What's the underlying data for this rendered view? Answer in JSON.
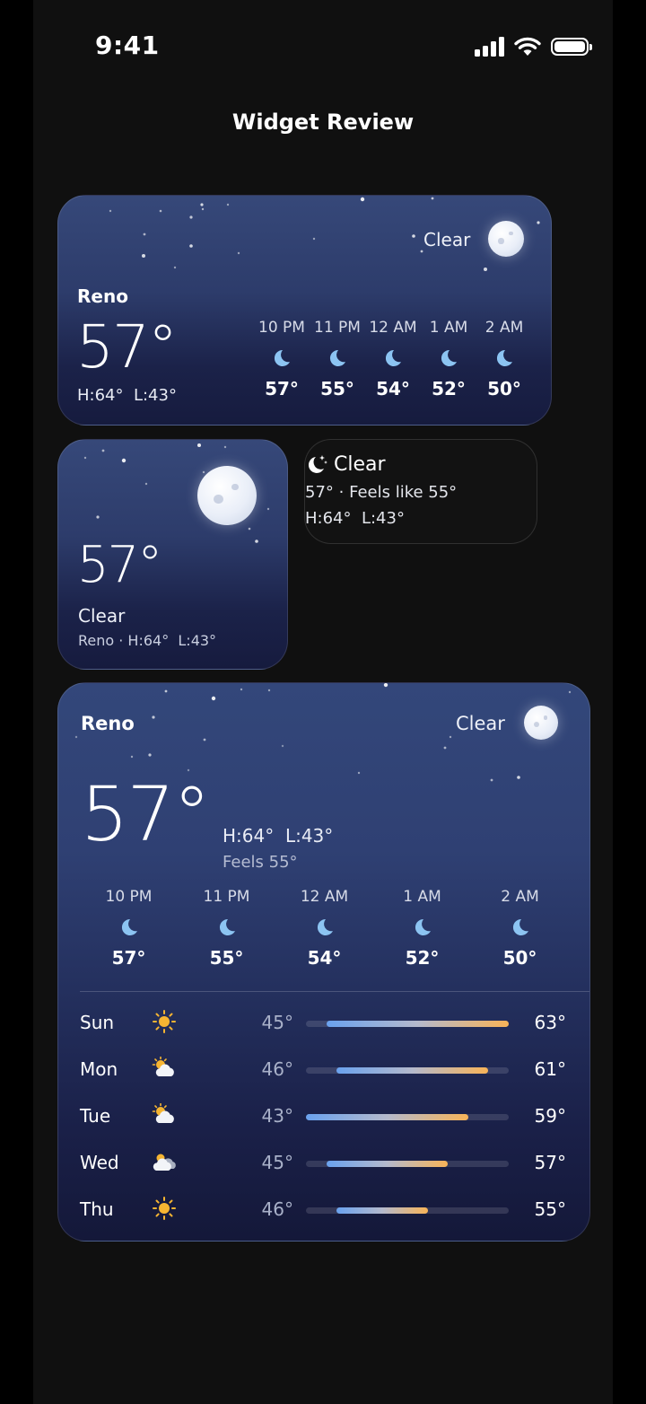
{
  "status_bar": {
    "time": "9:41"
  },
  "page": {
    "title": "Widget Review"
  },
  "medium_widget": {
    "city": "Reno",
    "temperature": "57°",
    "high": "H:64°",
    "low": "L:43°",
    "condition": "Clear",
    "condition_icon": "moon-icon",
    "hourly": [
      {
        "time": "10 PM",
        "icon": "crescent-moon-icon",
        "temp": "57°"
      },
      {
        "time": "11 PM",
        "icon": "crescent-moon-icon",
        "temp": "55°"
      },
      {
        "time": "12 AM",
        "icon": "crescent-moon-icon",
        "temp": "54°"
      },
      {
        "time": "1 AM",
        "icon": "crescent-moon-icon",
        "temp": "52°"
      },
      {
        "time": "2 AM",
        "icon": "crescent-moon-icon",
        "temp": "50°"
      }
    ]
  },
  "small_widget": {
    "temperature": "57°",
    "condition": "Clear",
    "detail": "Reno · H:64°  L:43°"
  },
  "inline_widget": {
    "condition": "Clear",
    "icon": "moon-stars-icon",
    "line1": "57° · Feels like 55°",
    "line2": "H:64°  L:43°"
  },
  "large_widget": {
    "city": "Reno",
    "condition": "Clear",
    "temperature": "57°",
    "high_low": "H:64°  L:43°",
    "feels": "Feels 55°",
    "hourly": [
      {
        "time": "10 PM",
        "icon": "crescent-moon-icon",
        "temp": "57°"
      },
      {
        "time": "11 PM",
        "icon": "crescent-moon-icon",
        "temp": "55°"
      },
      {
        "time": "12 AM",
        "icon": "crescent-moon-icon",
        "temp": "54°"
      },
      {
        "time": "1 AM",
        "icon": "crescent-moon-icon",
        "temp": "52°"
      },
      {
        "time": "2 AM",
        "icon": "crescent-moon-icon",
        "temp": "50°"
      }
    ],
    "range_scale": {
      "min_temp": 43,
      "max_temp": 63
    },
    "daily": [
      {
        "day": "Sun",
        "icon": "sun-icon",
        "low": "45°",
        "high": "63°",
        "low_value": 45,
        "high_value": 63
      },
      {
        "day": "Mon",
        "icon": "partly-cloudy-icon",
        "low": "46°",
        "high": "61°",
        "low_value": 46,
        "high_value": 61
      },
      {
        "day": "Tue",
        "icon": "partly-cloudy-icon",
        "low": "43°",
        "high": "59°",
        "low_value": 43,
        "high_value": 59
      },
      {
        "day": "Wed",
        "icon": "cloudy-icon",
        "low": "45°",
        "high": "57°",
        "low_value": 45,
        "high_value": 57
      },
      {
        "day": "Thu",
        "icon": "sun-icon",
        "low": "46°",
        "high": "55°",
        "low_value": 46,
        "high_value": 55
      }
    ]
  },
  "colors": {
    "sky_top": "#364879",
    "sky_bottom": "#161b3e",
    "moon_icon": "#8cc4f2",
    "sun_icon": "#f6b532",
    "range_cold": "#6aa2ee",
    "range_warm": "#f8b458"
  }
}
